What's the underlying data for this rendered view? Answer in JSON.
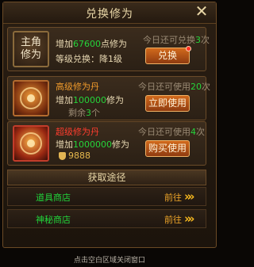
{
  "header": {
    "title": "兑换修为"
  },
  "cards": [
    {
      "icon_text": [
        "主角",
        "修为"
      ],
      "line1_prefix": "增加",
      "line1_amount": "67600",
      "line1_suffix": "点修为",
      "line2": "等级兑换：降1级",
      "today_prefix": "今日还可兑换",
      "today_count": "3",
      "today_suffix": "次",
      "button": "兑换"
    },
    {
      "name": "高级修为丹",
      "line1_prefix": "增加",
      "line1_amount": "100000",
      "line1_suffix": "修为",
      "remain_prefix": "剩余",
      "remain_count": "3",
      "remain_suffix": "个",
      "today_prefix": "今日还可使用",
      "today_count": "20",
      "today_suffix": "次",
      "button": "立即使用"
    },
    {
      "name": "超级修为丹",
      "line1_prefix": "增加",
      "line1_amount": "1000000",
      "line1_suffix": "修为",
      "price": "9888",
      "today_prefix": "今日还可使用",
      "today_count": "4",
      "today_suffix": "次",
      "button": "购买使用"
    }
  ],
  "section": {
    "title": "获取途径"
  },
  "sources": [
    {
      "name": "道具商店",
      "go": "前往"
    },
    {
      "name": "神秘商店",
      "go": "前往"
    }
  ],
  "footer": "点击空白区域关闭窗口"
}
